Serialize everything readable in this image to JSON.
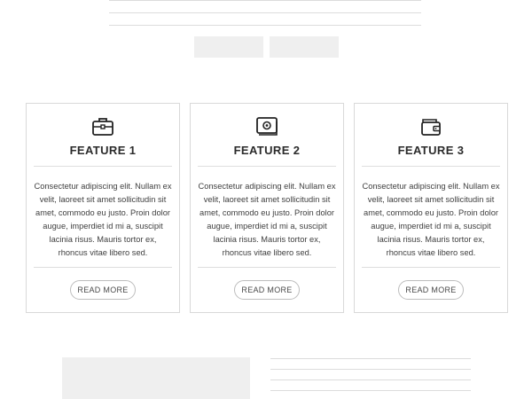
{
  "features": [
    {
      "icon": "briefcase-icon",
      "title": "FEATURE 1",
      "text": "Consectetur adipiscing elit. Nullam ex velit, laoreet sit amet sollicitudin sit amet, commodo eu justo. Proin dolor augue, imperdiet id mi a, suscipit lacinia risus. Mauris tortor ex, rhoncus vitae libero sed.",
      "button": "READ MORE"
    },
    {
      "icon": "money-icon",
      "title": "FEATURE 2",
      "text": "Consectetur adipiscing elit. Nullam ex velit, laoreet sit amet sollicitudin sit amet, commodo eu justo. Proin dolor augue, imperdiet id mi a, suscipit lacinia risus. Mauris tortor ex, rhoncus vitae libero sed.",
      "button": "READ MORE"
    },
    {
      "icon": "wallet-icon",
      "title": "FEATURE 3",
      "text": "Consectetur adipiscing elit. Nullam ex velit, laoreet sit amet sollicitudin sit amet, commodo eu justo. Proin dolor augue, imperdiet id mi a, suscipit lacinia risus. Mauris tortor ex, rhoncus vitae libero sed.",
      "button": "READ MORE"
    }
  ],
  "colors": {
    "placeholder": "#efefef",
    "line": "#dcdcdc",
    "border": "#d9d9d9"
  }
}
